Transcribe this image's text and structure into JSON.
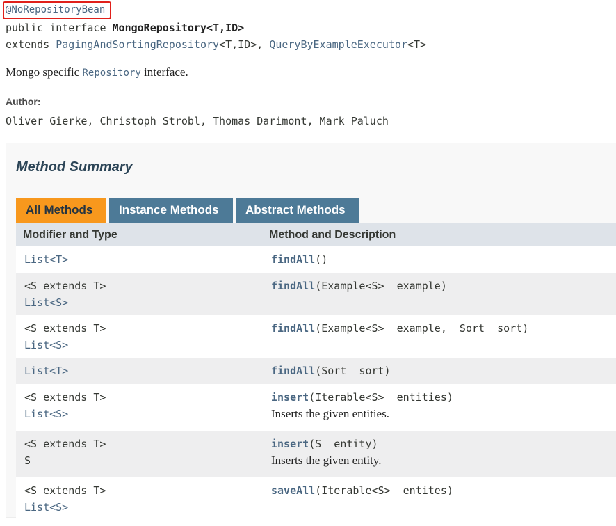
{
  "header": {
    "annotation": "@NoRepositoryBean",
    "sig_prefix": "public interface ",
    "sig_name": "MongoRepository<T,ID>",
    "extends_kw": "extends ",
    "extends_1": "PagingAndSortingRepository",
    "extends_1_generic": "<T,ID>, ",
    "extends_2": "QueryByExampleExecutor",
    "extends_2_generic": "<T>",
    "desc_prefix": "Mongo specific ",
    "desc_link": "Repository",
    "desc_suffix": " interface.",
    "author_label": "Author:",
    "authors": "Oliver Gierke, Christoph Strobl, Thomas Darimont, Mark Paluch"
  },
  "summary": {
    "title": "Method Summary",
    "tabs": [
      {
        "label": "All Methods",
        "active": true
      },
      {
        "label": "Instance Methods",
        "active": false
      },
      {
        "label": "Abstract Methods",
        "active": false
      }
    ],
    "col1_header": "Modifier and Type",
    "col2_header": "Method and Description",
    "rows": [
      {
        "type1": "List<T>",
        "type2": "",
        "method": "findAll",
        "params": "()",
        "desc": ""
      },
      {
        "type1": "<S extends T>",
        "type2": "List<S>",
        "method": "findAll",
        "params": "(Example<S>  example)",
        "desc": ""
      },
      {
        "type1": "<S extends T>",
        "type2": "List<S>",
        "method": "findAll",
        "params": "(Example<S>  example,  Sort  sort)",
        "desc": ""
      },
      {
        "type1": "List<T>",
        "type2": "",
        "method": "findAll",
        "params": "(Sort  sort)",
        "desc": ""
      },
      {
        "type1": "<S extends T>",
        "type2": "List<S>",
        "method": "insert",
        "params": "(Iterable<S>  entities)",
        "desc": "Inserts the given entities."
      },
      {
        "type1": "<S extends T>",
        "type2": "S",
        "method": "insert",
        "params": "(S  entity)",
        "desc": "Inserts the given entity."
      },
      {
        "type1": "<S extends T>",
        "type2": "List<S>",
        "method": "saveAll",
        "params": "(Iterable<S>  entites)",
        "desc": ""
      }
    ]
  },
  "colors": {
    "link": "#4A6782",
    "tab_active": "#F8981D",
    "tab_inactive": "#4D7A97",
    "highlight_box": "#e0201b"
  }
}
